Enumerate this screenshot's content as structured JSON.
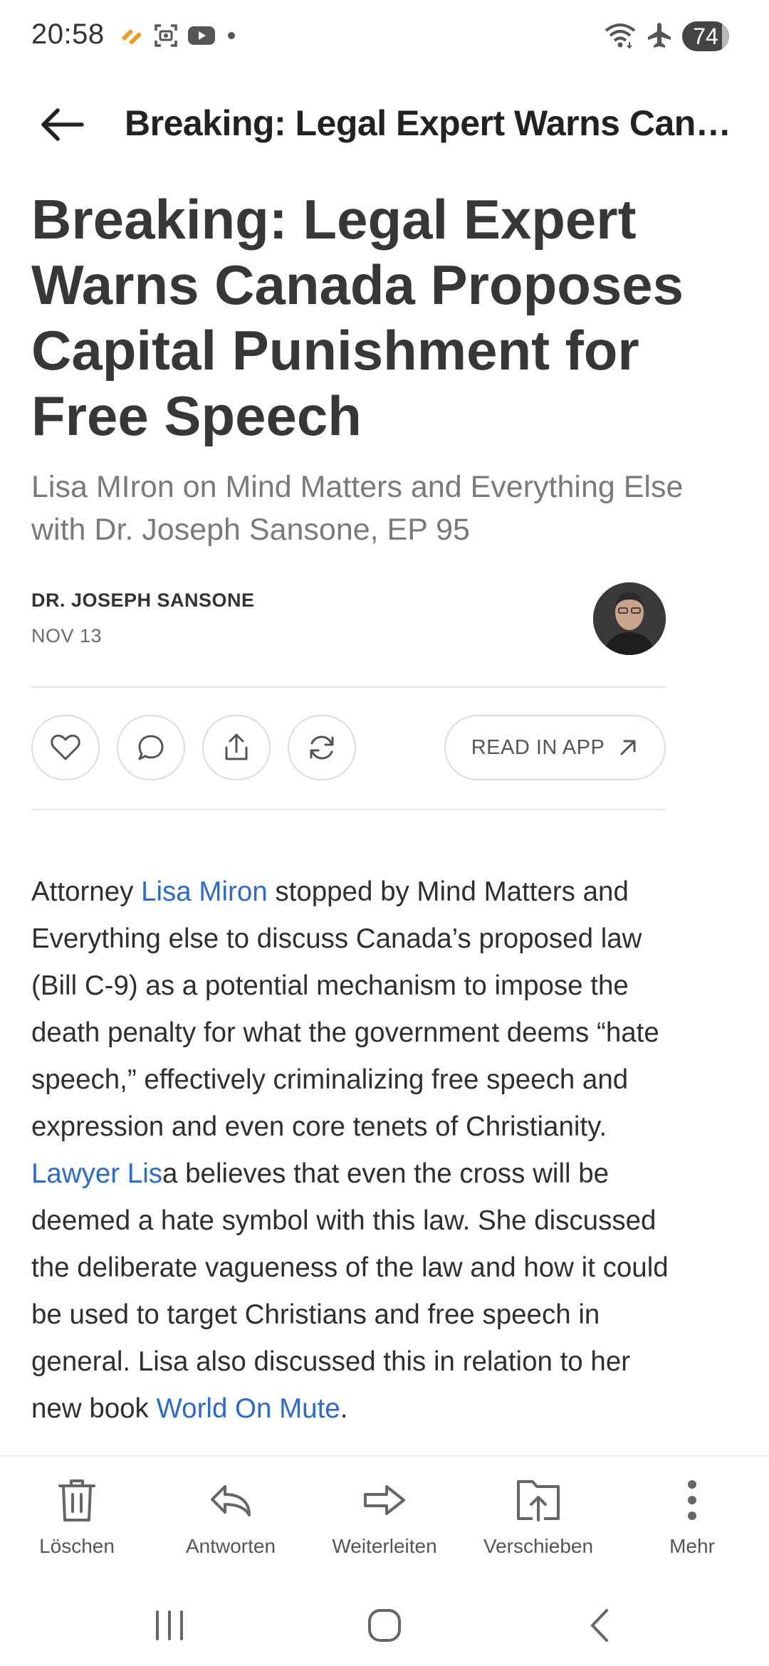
{
  "status_bar": {
    "time": "20:58",
    "battery": "74",
    "left_icons": [
      "hammer-notification-icon",
      "screenshot-icon",
      "youtube-icon",
      "dot-icon"
    ],
    "right_icons": [
      "wifi-icon",
      "airplane-mode-icon",
      "battery-icon"
    ]
  },
  "toolbar": {
    "title": "Breaking: Legal Expert Warns Canad..."
  },
  "article": {
    "title": "Breaking: Legal Expert Warns Canada Proposes Capital Punishment for Free Speech",
    "subtitle": "Lisa MIron on Mind Matters and Everything Else with Dr. Joseph Sansone, EP 95",
    "author": "DR. JOSEPH SANSONE",
    "date": "NOV 13",
    "body": {
      "p1": "Attorney ",
      "link1": "Lisa Miron",
      "p2": " stopped by Mind Matters and Everything else to discuss Canada’s proposed law (Bill C-9) as a potential mechanism to impose the death penalty for what the government deems “hate speech,” effectively criminalizing free speech and expression and even core tenets of Christianity. ",
      "link2": "Lawyer Lis",
      "p3": "a believes that even the cross will be deemed a hate symbol with this law. She discussed the deliberate vagueness of the law and how it could be used to target Christians and free speech in general. Lisa also discussed this in relation to her new book ",
      "link3": "World On Mute",
      "p4": "."
    }
  },
  "actions": {
    "read_in_app": "READ IN APP",
    "icons": [
      "heart-icon",
      "comment-icon",
      "share-icon",
      "restack-icon"
    ]
  },
  "bottom_bar": {
    "items": [
      {
        "label": "Löschen",
        "icon": "trash-icon"
      },
      {
        "label": "Antworten",
        "icon": "reply-icon"
      },
      {
        "label": "Weiterleiten",
        "icon": "forward-icon"
      },
      {
        "label": "Verschieben",
        "icon": "move-icon"
      },
      {
        "label": "Mehr",
        "icon": "more-icon"
      }
    ]
  },
  "colors": {
    "link": "#2a6ad6",
    "title": "#363737",
    "subtitle": "#7a7a7a",
    "accent_orange": "#f29a1f"
  }
}
